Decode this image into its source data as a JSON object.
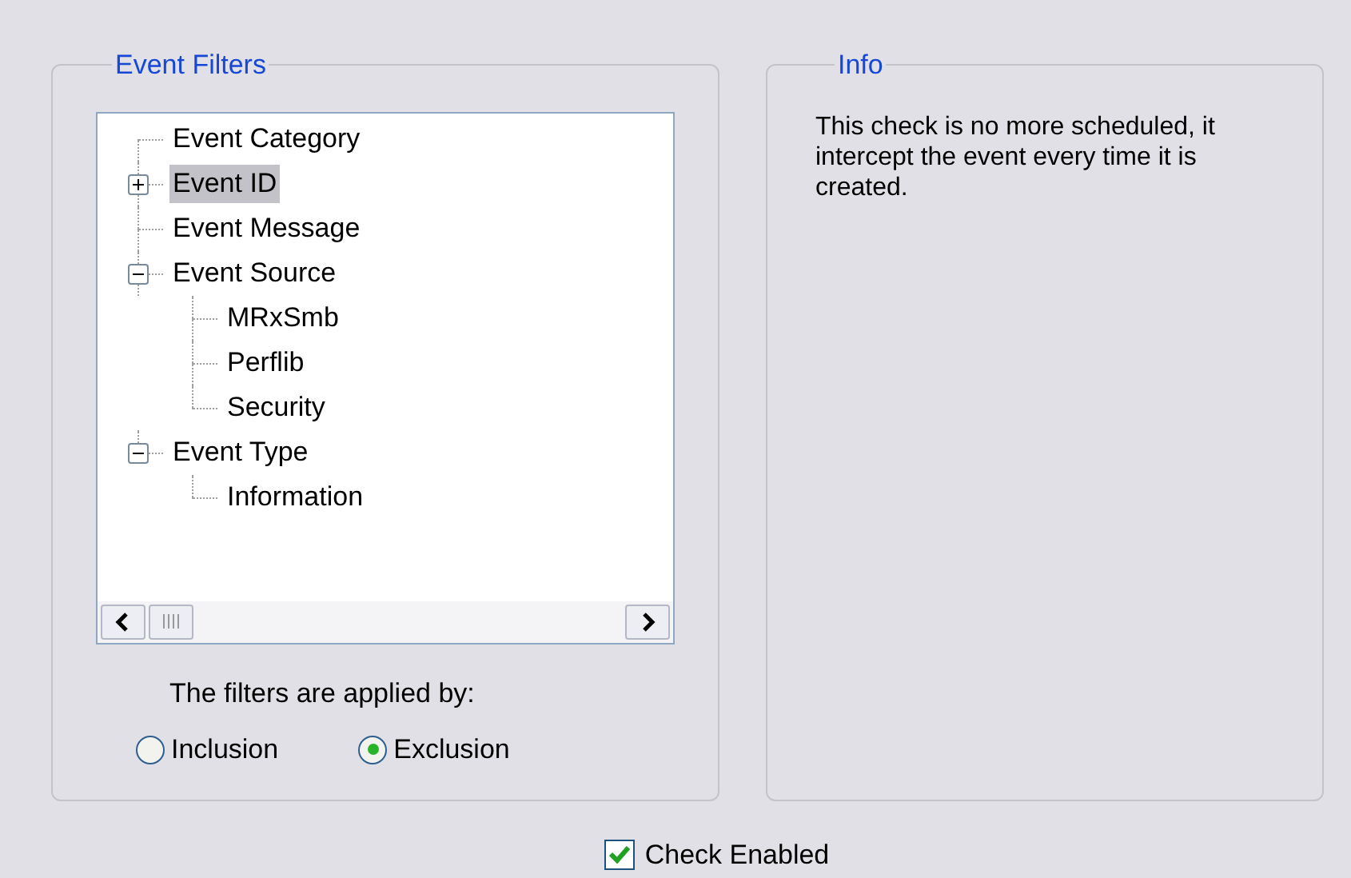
{
  "event_filters": {
    "title": "Event Filters",
    "tree": [
      {
        "label": "Event Category",
        "selected": false
      },
      {
        "label": "Event ID",
        "selected": true,
        "expanded": false
      },
      {
        "label": "Event Message",
        "selected": false
      },
      {
        "label": "Event Source",
        "selected": false,
        "expanded": true,
        "children": [
          {
            "label": "MRxSmb",
            "selected": false
          },
          {
            "label": "Perflib",
            "selected": false
          },
          {
            "label": "Security",
            "selected": false
          }
        ]
      },
      {
        "label": "Event Type",
        "selected": false,
        "expanded": true,
        "children": [
          {
            "label": "Information",
            "selected": false
          }
        ]
      }
    ],
    "applied_by_label": "The filters are applied by:",
    "options": [
      {
        "label": "Inclusion",
        "selected": false
      },
      {
        "label": "Exclusion",
        "selected": true
      }
    ]
  },
  "info": {
    "title": "Info",
    "text": "This check is no more scheduled, it intercept the event every time it is created."
  },
  "check_enabled": {
    "label": "Check Enabled",
    "checked": true
  }
}
